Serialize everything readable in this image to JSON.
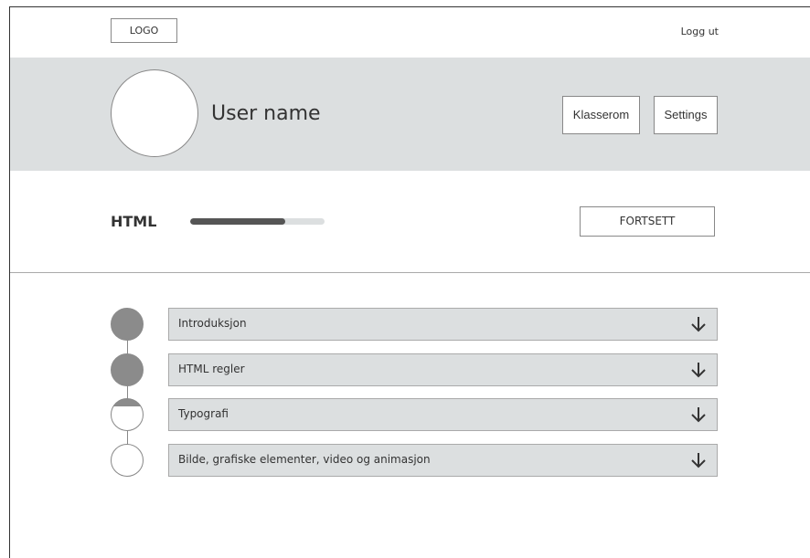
{
  "header": {
    "logo_label": "LOGO",
    "logout_label": "Logg ut"
  },
  "profile": {
    "username": "User name",
    "classroom_label": "Klasserom",
    "settings_label": "Settings"
  },
  "course": {
    "title": "HTML",
    "progress": 0.71,
    "continue_label": "FORTSETT"
  },
  "modules": [
    {
      "label": "Introduksjon",
      "status": "done"
    },
    {
      "label": "HTML regler",
      "status": "done"
    },
    {
      "label": "Typografi",
      "status": "partial"
    },
    {
      "label": "Bilde, grafiske elementer, video og animasjon",
      "status": "empty"
    }
  ],
  "colors": {
    "band": "#dcdfe0",
    "progress": "#555555",
    "done_dot": "#8b8b8b"
  }
}
